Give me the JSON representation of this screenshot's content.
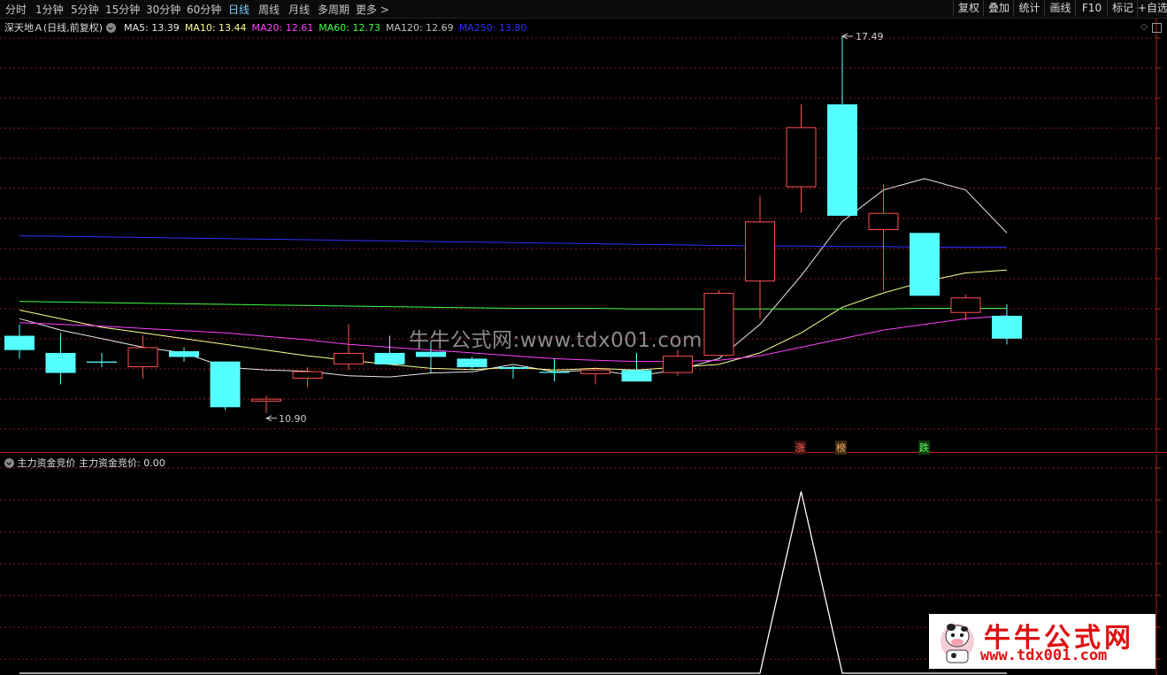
{
  "toolbar": {
    "periods": [
      "分时",
      "1分钟",
      "5分钟",
      "15分钟",
      "30分钟",
      "60分钟",
      "日线",
      "周线",
      "月线",
      "多周期",
      "更多 >"
    ],
    "active_period": "日线",
    "right_buttons": [
      "复权",
      "叠加",
      "统计",
      "画线",
      "F10",
      "标记",
      "+自选"
    ]
  },
  "stock": {
    "name": "深天地Ａ",
    "mode": "(日线,前复权)"
  },
  "ma_legend": [
    {
      "label": "MA5: 13.39",
      "color": "#e8e8e8"
    },
    {
      "label": "MA10: 13.44",
      "color": "#ffff90"
    },
    {
      "label": "MA20: 12.61",
      "color": "#ff40ff"
    },
    {
      "label": "MA60: 12.73",
      "color": "#40ff40"
    },
    {
      "label": "MA120: 12.69",
      "color": "#c0c0c0"
    },
    {
      "label": "MA250: 13.80",
      "color": "#3030ff"
    }
  ],
  "price_labels": {
    "high": "17.49",
    "low": "10.90"
  },
  "flags": [
    "涨",
    "榜",
    "跌"
  ],
  "indicator": {
    "name": "主力资金竞价",
    "value_label": "主力资金竞价: 0.00"
  },
  "watermark": "牛牛公式网:www.tdx001.com",
  "logo": {
    "title": "牛牛公式网",
    "url": "www.tdx001.com"
  },
  "colors": {
    "up": "#ff5050",
    "down": "#54ffff",
    "grid": "#8b1a1a",
    "border": "#b02020"
  },
  "chart_data": {
    "type": "candlestick",
    "series": [
      {
        "name": "K",
        "values": [
          {
            "o": 12.25,
            "h": 12.45,
            "l": 11.85,
            "c": 12.0
          },
          {
            "o": 11.95,
            "h": 12.3,
            "l": 11.4,
            "c": 11.6
          },
          {
            "o": 11.8,
            "h": 11.95,
            "l": 11.7,
            "c": 11.78
          },
          {
            "o": 11.7,
            "h": 12.25,
            "l": 11.5,
            "c": 12.05
          },
          {
            "o": 11.98,
            "h": 12.05,
            "l": 11.8,
            "c": 11.88
          },
          {
            "o": 11.8,
            "h": 11.8,
            "l": 10.95,
            "c": 11.0
          },
          {
            "o": 11.1,
            "h": 11.2,
            "l": 10.9,
            "c": 11.15
          },
          {
            "o": 11.5,
            "h": 11.7,
            "l": 11.35,
            "c": 11.63
          },
          {
            "o": 11.75,
            "h": 12.45,
            "l": 11.65,
            "c": 11.95
          },
          {
            "o": 11.95,
            "h": 12.25,
            "l": 11.75,
            "c": 11.75
          },
          {
            "o": 11.97,
            "h": 12.15,
            "l": 11.6,
            "c": 11.88
          },
          {
            "o": 11.85,
            "h": 11.88,
            "l": 11.65,
            "c": 11.7
          },
          {
            "o": 11.7,
            "h": 11.72,
            "l": 11.5,
            "c": 11.67
          },
          {
            "o": 11.62,
            "h": 11.85,
            "l": 11.45,
            "c": 11.6
          },
          {
            "o": 11.58,
            "h": 11.7,
            "l": 11.4,
            "c": 11.66
          },
          {
            "o": 11.65,
            "h": 11.95,
            "l": 11.45,
            "c": 11.45
          },
          {
            "o": 11.6,
            "h": 12.0,
            "l": 11.55,
            "c": 11.9
          },
          {
            "o": 11.9,
            "h": 13.05,
            "l": 11.9,
            "c": 13.0
          },
          {
            "o": 13.2,
            "h": 14.7,
            "l": 12.55,
            "c": 14.25
          },
          {
            "o": 14.85,
            "h": 16.3,
            "l": 14.4,
            "c": 15.9
          },
          {
            "o": 16.3,
            "h": 17.49,
            "l": 14.4,
            "c": 14.35
          },
          {
            "o": 14.1,
            "h": 14.9,
            "l": 13.05,
            "c": 14.4
          },
          {
            "o": 14.05,
            "h": 14.05,
            "l": 12.95,
            "c": 12.95
          },
          {
            "o": 12.65,
            "h": 12.97,
            "l": 12.52,
            "c": 12.92
          },
          {
            "o": 12.6,
            "h": 12.8,
            "l": 12.1,
            "c": 12.2
          }
        ]
      },
      {
        "name": "MA5",
        "values": [
          12.55,
          12.35,
          12.2,
          12.05,
          11.95,
          11.7,
          11.65,
          11.63,
          11.55,
          11.53,
          11.6,
          11.62,
          11.75,
          11.62,
          11.65,
          11.55,
          11.65,
          11.85,
          12.45,
          13.3,
          14.25,
          14.8,
          15.0,
          14.8,
          14.05
        ]
      },
      {
        "name": "MA10",
        "values": [
          12.7,
          12.55,
          12.4,
          12.3,
          12.2,
          12.1,
          12.0,
          11.9,
          11.82,
          11.75,
          11.68,
          11.66,
          11.7,
          11.65,
          11.68,
          11.65,
          11.7,
          11.75,
          11.95,
          12.3,
          12.75,
          13.0,
          13.2,
          13.35,
          13.4
        ]
      },
      {
        "name": "MA20",
        "values": [
          12.48,
          12.45,
          12.42,
          12.38,
          12.34,
          12.3,
          12.24,
          12.18,
          12.1,
          12.05,
          12.0,
          11.95,
          11.9,
          11.85,
          11.82,
          11.8,
          11.8,
          11.82,
          11.9,
          12.05,
          12.2,
          12.35,
          12.45,
          12.55,
          12.6
        ]
      },
      {
        "name": "MA60",
        "values": [
          12.85,
          12.84,
          12.83,
          12.82,
          12.81,
          12.8,
          12.79,
          12.78,
          12.77,
          12.76,
          12.75,
          12.74,
          12.73,
          12.73,
          12.73,
          12.72,
          12.72,
          12.72,
          12.72,
          12.72,
          12.72,
          12.72,
          12.73,
          12.73,
          12.73
        ]
      },
      {
        "name": "MA250",
        "values": [
          14.0,
          13.99,
          13.98,
          13.97,
          13.96,
          13.95,
          13.94,
          13.93,
          13.92,
          13.91,
          13.9,
          13.89,
          13.88,
          13.87,
          13.86,
          13.85,
          13.84,
          13.83,
          13.82,
          13.82,
          13.81,
          13.81,
          13.8,
          13.8,
          13.8
        ]
      },
      {
        "name": "主力资金竞价",
        "values": [
          0,
          0,
          0,
          0,
          0,
          0,
          0,
          0,
          0,
          0,
          0,
          0,
          0,
          0,
          0,
          0,
          0,
          0,
          0,
          1,
          0,
          0,
          0,
          0,
          0
        ]
      }
    ],
    "ylim": [
      10.2,
      17.8
    ],
    "indicator_ylim": [
      0,
      1.1
    ]
  }
}
